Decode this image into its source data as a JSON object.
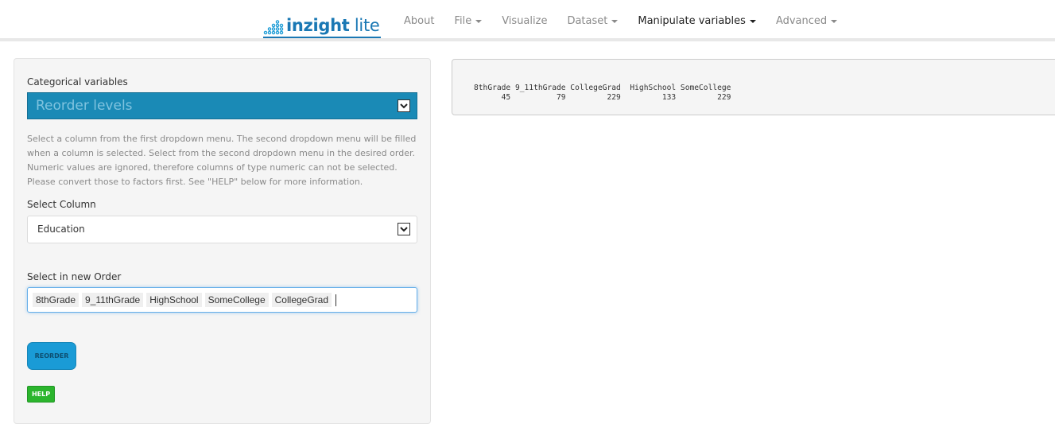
{
  "brand": {
    "part1": "inz",
    "part2": "i",
    "part3": "ght",
    "part4": " lite"
  },
  "nav": {
    "items": [
      {
        "label": "About",
        "dropdown": false,
        "active": false
      },
      {
        "label": "File",
        "dropdown": true,
        "active": false
      },
      {
        "label": "Visualize",
        "dropdown": false,
        "active": false
      },
      {
        "label": "Dataset",
        "dropdown": true,
        "active": false
      },
      {
        "label": "Manipulate variables",
        "dropdown": true,
        "active": true
      },
      {
        "label": "Advanced",
        "dropdown": true,
        "active": false
      }
    ]
  },
  "sidebar": {
    "section_label": "Categorical variables",
    "action_select": {
      "value": "Reorder levels"
    },
    "help_text": "Select a column from the first dropdown menu. The second dropdown menu will be filled when a column is selected. Select from the second dropdown menu in the desired order. Numeric values are ignored, therefore columns of type numeric can not be selected. Please convert those to factors first. See \"HELP\" below for more information.",
    "column_label": "Select Column",
    "column_select": {
      "value": "Education"
    },
    "order_label": "Select in new Order",
    "order_items": [
      "8thGrade",
      "9_11thGrade",
      "HighSchool",
      "SomeCollege",
      "CollegeGrad"
    ],
    "reorder_button": "REORDER",
    "help_button": "HELP"
  },
  "output": {
    "lines": [
      "8thGrade 9_11thGrade CollegeGrad  HighSchool SomeCollege",
      "      45          79         229         133         229"
    ]
  },
  "colors": {
    "brand": "#1a78b4",
    "select_blue": "#1a8ab6",
    "reorder_button": "#1a9bd6",
    "help_button": "#2bb52d"
  }
}
